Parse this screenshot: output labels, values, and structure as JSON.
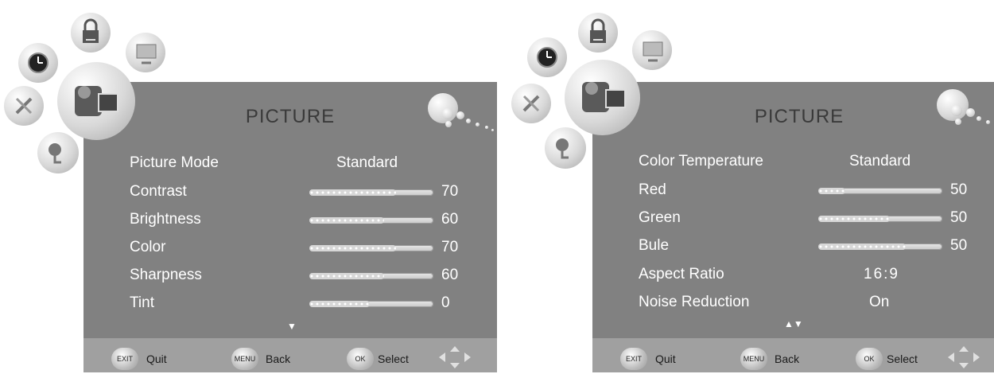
{
  "screens": [
    {
      "title": "PICTURE",
      "rows": [
        {
          "label": "Picture Mode",
          "kind": "text",
          "value": "Standard"
        },
        {
          "label": "Contrast",
          "kind": "slider",
          "value": "70"
        },
        {
          "label": "Brightness",
          "kind": "slider",
          "value": "60"
        },
        {
          "label": "Color",
          "kind": "slider",
          "value": "70"
        },
        {
          "label": "Sharpness",
          "kind": "slider",
          "value": "60"
        },
        {
          "label": "Tint",
          "kind": "slider",
          "value": "0"
        }
      ],
      "scroll_indicator": "▼"
    },
    {
      "title": "PICTURE",
      "rows": [
        {
          "label": "Color  Temperature",
          "kind": "text",
          "value": "Standard"
        },
        {
          "label": "Red",
          "kind": "slider",
          "value": "50"
        },
        {
          "label": "Green",
          "kind": "slider",
          "value": "50"
        },
        {
          "label": "Bule",
          "kind": "slider",
          "value": "50"
        },
        {
          "label": "Aspect  Ratio",
          "kind": "text",
          "value": "16:9"
        },
        {
          "label": "Noise  Reduction",
          "kind": "text",
          "value": "On"
        }
      ],
      "scroll_indicator": "▲▼"
    }
  ],
  "footer": {
    "exit_key": "EXIT",
    "exit_label": "Quit",
    "menu_key": "MENU",
    "menu_label": "Back",
    "ok_key": "OK",
    "ok_label": "Select"
  },
  "icons": [
    "lock-icon",
    "clock-icon",
    "monitor-icon",
    "camera-icon",
    "tools-icon",
    "speaker-icon",
    "dpad-icon"
  ],
  "colors": {
    "panel": "#818181",
    "footer": "#a0a0a0",
    "text": "#ffffff",
    "title": "#3a3a3a"
  }
}
